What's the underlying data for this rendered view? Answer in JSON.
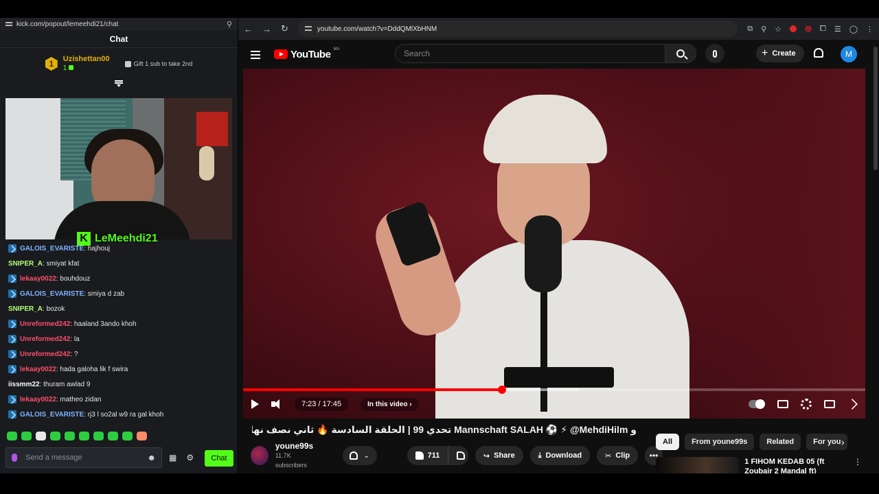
{
  "kick": {
    "url": "kick.com/popout/lemeehdi21/chat",
    "title": "Chat",
    "top_gifter": {
      "rank": "1",
      "name": "Uzishettan00",
      "count": "1",
      "cta": "Gift 1 sub to take 2nd"
    },
    "streamer_name": "LeMeehdi21",
    "messages": [
      {
        "user": "GALOIS_EVARISTE",
        "text": ": hajhouj",
        "color": "#7fb4ff",
        "badge": true
      },
      {
        "user": "SNIPER_A",
        "text": ": smiyat kfat",
        "color": "#ffffff",
        "badge": false
      },
      {
        "user": "lekaay0022",
        "text": ": bouhdouz",
        "color": "#ff4d6d",
        "badge": true
      },
      {
        "user": "GALOIS_EVARISTE",
        "text": ": smiya d zab",
        "color": "#7fb4ff",
        "badge": true
      },
      {
        "user": "SNIPER_A",
        "text": ": bozok",
        "color": "#ffffff",
        "badge": false
      },
      {
        "user": "Unreformed242",
        "text": ": haaland 3ando khoh",
        "color": "#ff4d6d",
        "badge": true
      },
      {
        "user": "Unreformed242",
        "text": ": la",
        "color": "#ff4d6d",
        "badge": true
      },
      {
        "user": "Unreformed242",
        "text": ": ?",
        "color": "#ff4d6d",
        "badge": true
      },
      {
        "user": "lekaay0022",
        "text": ": hada galoha lik f swira",
        "color": "#ff4d6d",
        "badge": true
      },
      {
        "user": "iissmm22",
        "text": ": thuram awlad 9",
        "color": "#ffffff",
        "badge": false
      },
      {
        "user": "lekaay0022",
        "text": ": matheo zidan",
        "color": "#ff4d6d",
        "badge": true
      },
      {
        "user": "GALOIS_EVARISTE",
        "text": ": rj3 l so2al w9 ra gal khoh",
        "color": "#7fb4ff",
        "badge": true
      }
    ],
    "input_placeholder": "Send a message",
    "send_label": "Chat",
    "accent": "#53fc18"
  },
  "browser": {
    "url": "youtube.com/watch?v=DddQMlXbHNM"
  },
  "youtube": {
    "logo": "YouTube",
    "country": "MA",
    "search_placeholder": "Search",
    "create_label": "Create",
    "avatar_letter": "M",
    "player": {
      "current_time": "7:23",
      "duration": "17:45",
      "played_fraction": 0.416,
      "buffered_fraction": 0.54,
      "in_this_video": "In this video"
    },
    "video_title": "و Mannschaft SALAH ⚽ ⚡ @MehdiHilm تحدي 99 | الحلقة السادسة 🔥 ثاني نصف نهائي بين",
    "channel": {
      "name": "youne99s",
      "subscribers": "11.7K subscribers"
    },
    "actions": {
      "likes": "711",
      "share": "Share",
      "download": "Download",
      "clip": "Clip"
    },
    "chips": [
      "All",
      "From youne99s",
      "Related",
      "For you"
    ],
    "recommendation": {
      "title": "1 FIHOM KEDAB 05 (ft Zoubair 2 Mandal ft)"
    }
  }
}
